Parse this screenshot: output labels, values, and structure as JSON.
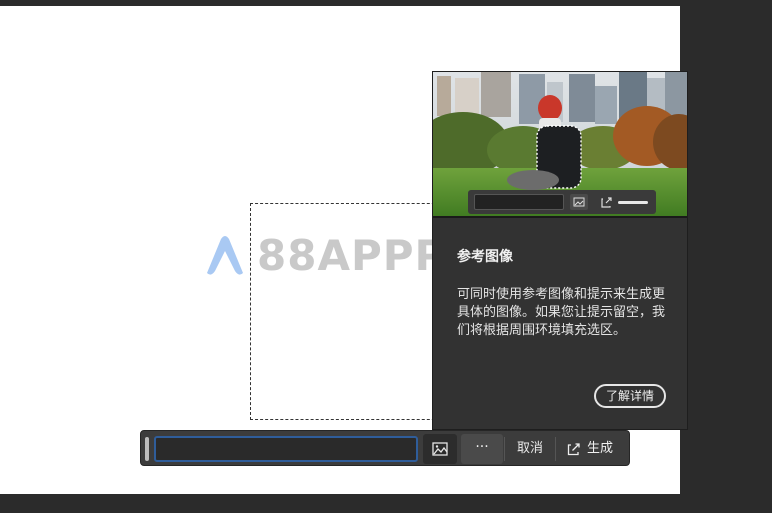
{
  "watermark": {
    "text": "88APPP.COM"
  },
  "popover": {
    "title": "参考图像",
    "body": "可同时使用参考图像和提示来生成更具体的图像。如果您让提示留空，我们将根据周围环境填充选区。",
    "learn_more": "了解详情"
  },
  "taskbar": {
    "prompt_value": "",
    "more_label": "···",
    "cancel_label": "取消",
    "generate_label": "生成"
  },
  "colors": {
    "ui_dark": "#3c3c3c",
    "input_focus_border": "#2f5d9a",
    "popover_bg": "#323232"
  }
}
